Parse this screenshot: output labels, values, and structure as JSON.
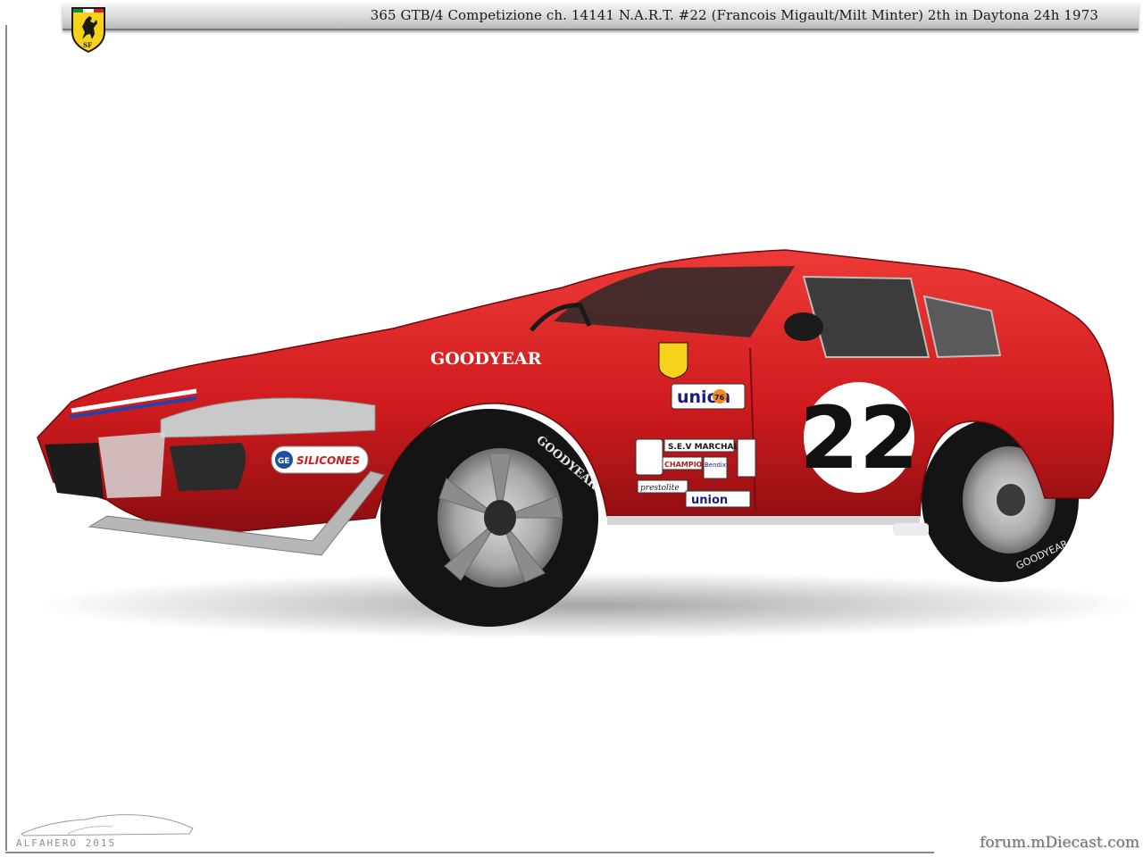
{
  "header": {
    "title": "365 GTB/4 Competizione  ch. 14141  N.A.R.T.  #22 (Francois Migault/Milt Minter)  2th in Daytona 24h 1973",
    "logo_icon": "ferrari-prancing-horse-shield",
    "logo_lettering": "SF"
  },
  "photo": {
    "decals": {
      "brand_side": "GOODYEAR",
      "sponsor_union": "union",
      "sponsor_union_num": "76",
      "race_number": "22",
      "ge": "GE",
      "silicones": "SILICONES",
      "sev_marchal": "S.E.V MARCHAL",
      "champion": "CHAMPION",
      "bendix": "Bendix",
      "prestolite": "prestolite",
      "union_small": "union",
      "tyre_front": "GOODYEAR",
      "tyre_rear": "GOODYEAR"
    }
  },
  "footer": {
    "alfa_logo_text": "ALFAHERO 2015",
    "forum_watermark": "forum.mDiecast.com"
  },
  "colors": {
    "body_red": "#cf1b1e",
    "roundel_white": "#ffffff",
    "frame_gray": "#8a8a8a",
    "shield_yellow": "#f6d21b"
  }
}
